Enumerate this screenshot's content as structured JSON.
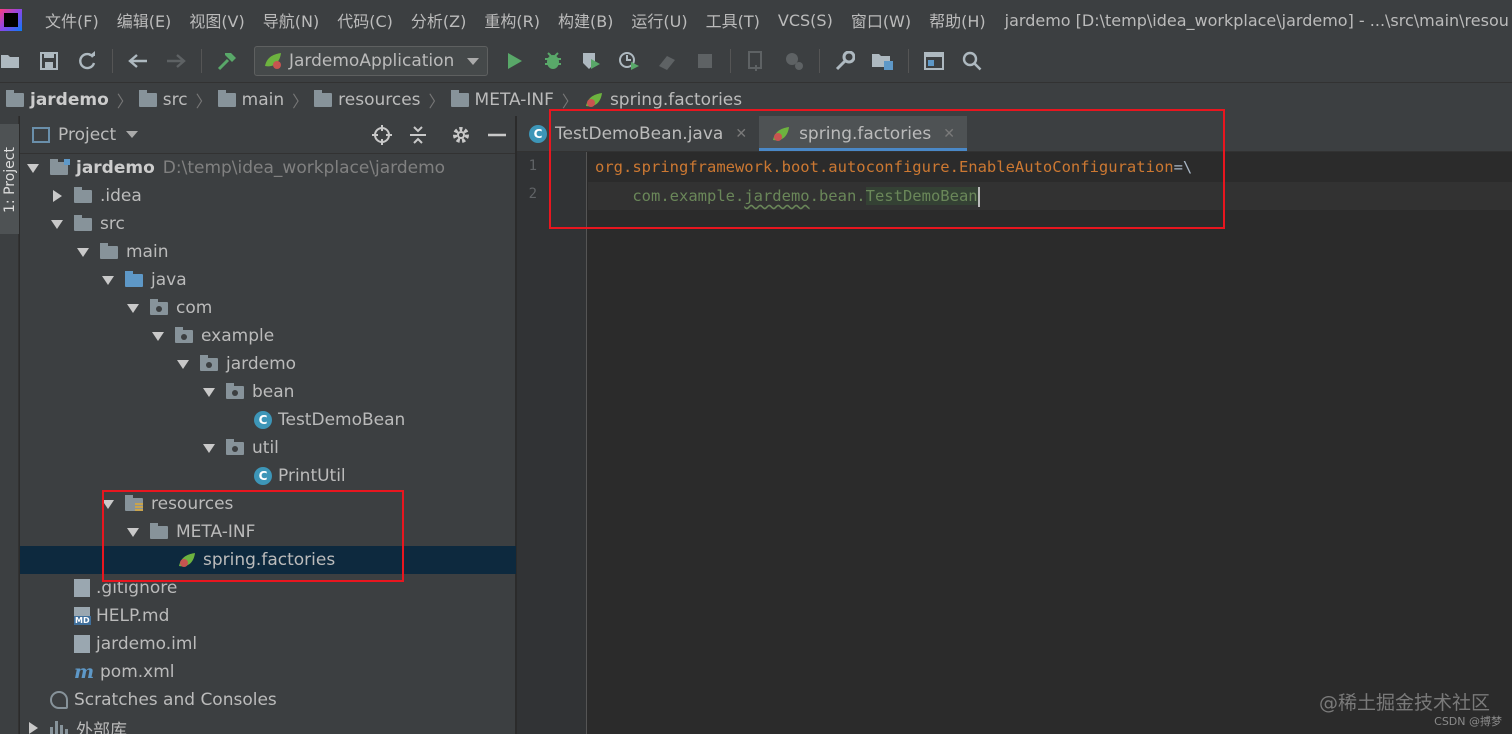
{
  "menubar": {
    "items": [
      "文件(F)",
      "编辑(E)",
      "视图(V)",
      "导航(N)",
      "代码(C)",
      "分析(Z)",
      "重构(R)",
      "构建(B)",
      "运行(U)",
      "工具(T)",
      "VCS(S)",
      "窗口(W)",
      "帮助(H)"
    ],
    "window_title": "jardemo [D:\\temp\\idea_workplace\\jardemo] - ...\\src\\main\\resou"
  },
  "toolbar": {
    "run_config": "JardemoApplication"
  },
  "breadcrumb": {
    "items": [
      "jardemo",
      "src",
      "main",
      "resources",
      "META-INF",
      "spring.factories"
    ]
  },
  "left_stripe": {
    "label": "1: Project"
  },
  "project_panel": {
    "title": "Project",
    "tree": [
      {
        "label": "jardemo",
        "hint": "D:\\temp\\idea_workplace\\jardemo"
      },
      {
        "label": ".idea"
      },
      {
        "label": "src"
      },
      {
        "label": "main"
      },
      {
        "label": "java"
      },
      {
        "label": "com"
      },
      {
        "label": "example"
      },
      {
        "label": "jardemo"
      },
      {
        "label": "bean"
      },
      {
        "label": "TestDemoBean"
      },
      {
        "label": "util"
      },
      {
        "label": "PrintUtil"
      },
      {
        "label": "resources"
      },
      {
        "label": "META-INF"
      },
      {
        "label": "spring.factories"
      },
      {
        "label": ".gitignore"
      },
      {
        "label": "HELP.md"
      },
      {
        "label": "jardemo.iml"
      },
      {
        "label": "pom.xml"
      },
      {
        "label": "Scratches and Consoles"
      },
      {
        "label": "外部库"
      }
    ],
    "selected_item": "spring.factories"
  },
  "editor": {
    "tabs": [
      {
        "label": "TestDemoBean.java",
        "active": false
      },
      {
        "label": "spring.factories",
        "active": true
      }
    ],
    "line_numbers": [
      "1",
      "2"
    ],
    "line1": {
      "key": "org.springframework.boot.autoconfigure.EnableAutoConfiguration",
      "eq": "=",
      "cont": "\\"
    },
    "line2": {
      "indent": "    ",
      "pkg_a": "com.example.",
      "pkg_b": "jardemo",
      "pkg_c": ".bean.",
      "cls": "TestDemoBean"
    }
  },
  "watermark": {
    "main": "@稀土掘金技术社区",
    "small": "CSDN @搏梦"
  },
  "colors": {
    "annotation_red": "#e8161f",
    "selection": "#0d293e",
    "keyword_orange": "#cc7832",
    "string_green": "#6a8759"
  }
}
